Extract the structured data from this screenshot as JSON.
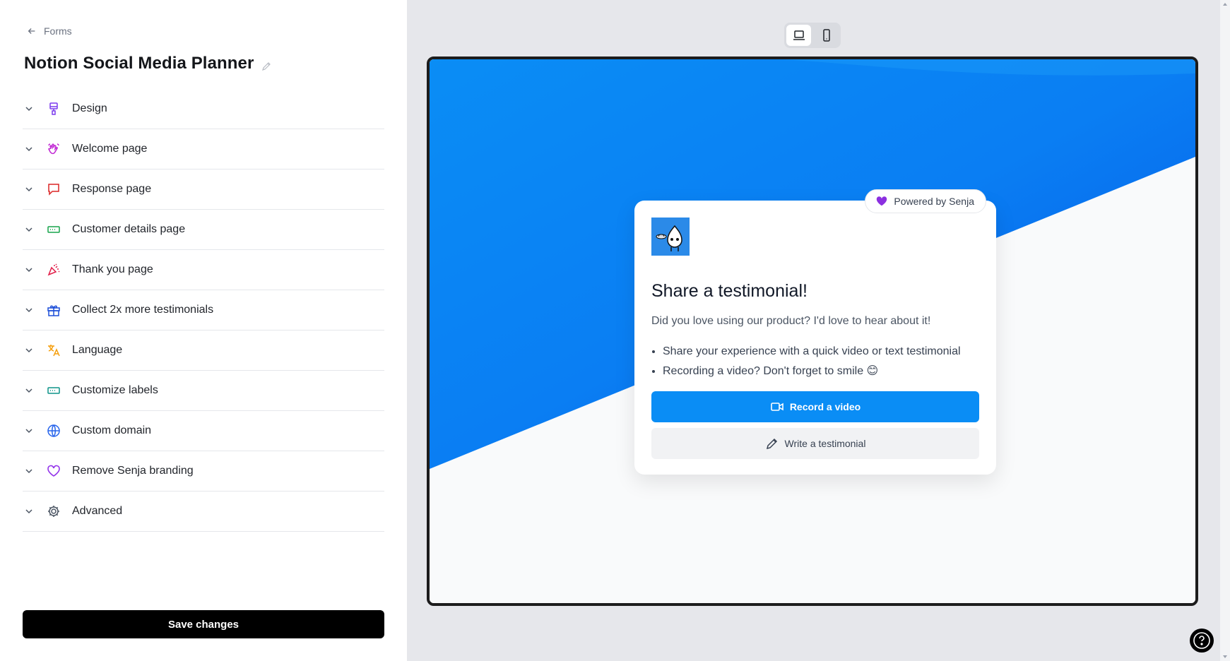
{
  "nav": {
    "back_label": "Forms",
    "back_icon": "arrow-left-icon"
  },
  "form": {
    "title": "Notion Social Media Planner"
  },
  "sections": [
    {
      "label": "Design",
      "icon": "paint-brush-icon",
      "color": "#7c3aed"
    },
    {
      "label": "Welcome page",
      "icon": "waving-hand-icon",
      "color": "#c026d3"
    },
    {
      "label": "Response page",
      "icon": "chat-bubble-icon",
      "color": "#dc2626"
    },
    {
      "label": "Customer details page",
      "icon": "form-input-icon",
      "color": "#16a34a"
    },
    {
      "label": "Thank you page",
      "icon": "party-popper-icon",
      "color": "#e11d48"
    },
    {
      "label": "Collect 2x more testimonials",
      "icon": "gift-icon",
      "color": "#1d4ed8"
    },
    {
      "label": "Language",
      "icon": "translate-icon",
      "color": "#f59e0b"
    },
    {
      "label": "Customize labels",
      "icon": "label-input-icon",
      "color": "#0d9488"
    },
    {
      "label": "Custom domain",
      "icon": "globe-icon",
      "color": "#2563eb"
    },
    {
      "label": "Remove Senja branding",
      "icon": "heart-icon",
      "color": "#9333ea"
    },
    {
      "label": "Advanced",
      "icon": "gear-icon",
      "color": "#4b5563"
    }
  ],
  "save_label": "Save changes",
  "device_toggle": {
    "selected": "desktop",
    "options": [
      "desktop",
      "mobile"
    ]
  },
  "preview": {
    "powered_by": "Powered by Senja",
    "heading": "Share a testimonial!",
    "description": "Did you love using our product? I'd love to hear about it!",
    "bullets": [
      "Share your experience with a quick video or text testimonial",
      "Recording a video? Don't forget to smile 😊"
    ],
    "record_label": "Record a video",
    "write_label": "Write a testimonial",
    "accent": "#0a8df5"
  }
}
